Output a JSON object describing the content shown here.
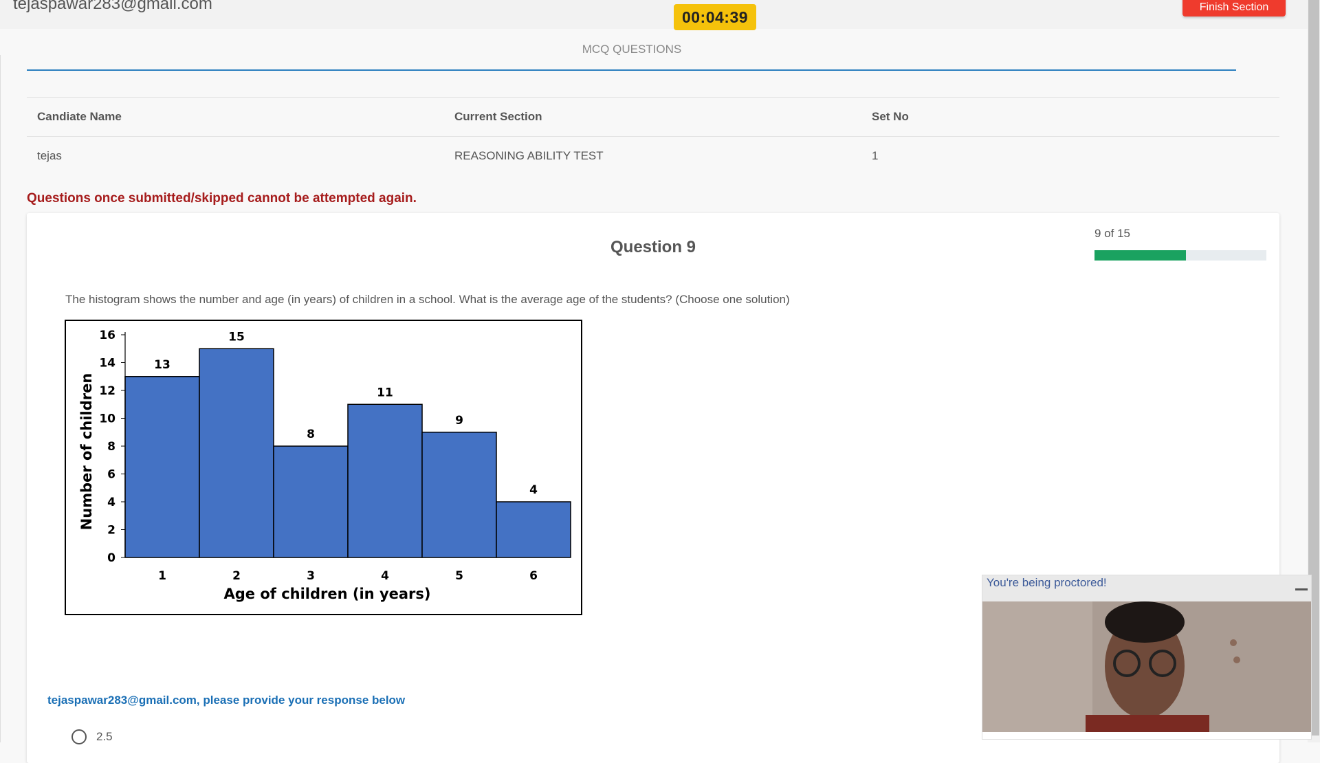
{
  "header": {
    "user_email": "tejaspawar283@gmail.com",
    "timer": "00:04:39",
    "finish_label": "Finish Section"
  },
  "section": {
    "title": "MCQ QUESTIONS"
  },
  "info_table": {
    "headers": [
      "Candiate Name",
      "Current Section",
      "Set No"
    ],
    "values": [
      "tejas",
      "REASONING ABILITY TEST",
      "1"
    ]
  },
  "warning": "Questions once submitted/skipped cannot be attempted again.",
  "question": {
    "title": "Question 9",
    "progress_text": "9 of 15",
    "progress_fraction": 0.5333,
    "text": "The histogram shows the number and age (in years) of children in a school. What is the average age of the students? (Choose one solution)"
  },
  "chart_data": {
    "type": "bar",
    "categories": [
      "1",
      "2",
      "3",
      "4",
      "5",
      "6"
    ],
    "values": [
      13,
      15,
      8,
      11,
      9,
      4
    ],
    "xlabel": "Age of children (in years)",
    "ylabel": "Number of children",
    "ylim": [
      0,
      16
    ],
    "yticks": [
      0,
      2,
      4,
      6,
      8,
      10,
      12,
      14,
      16
    ],
    "bar_color": "#4472c4",
    "grid": false
  },
  "response": {
    "prompt": "tejaspawar283@gmail.com, please provide your response below",
    "options": [
      "2.5"
    ]
  },
  "proctor": {
    "title": "You're being proctored!"
  },
  "colors": {
    "timer_bg": "#f5c20b",
    "finish_bg": "#ef3b2d",
    "warning": "#a61c1c",
    "progress": "#1aa260",
    "section_line": "#2b7fbf"
  }
}
